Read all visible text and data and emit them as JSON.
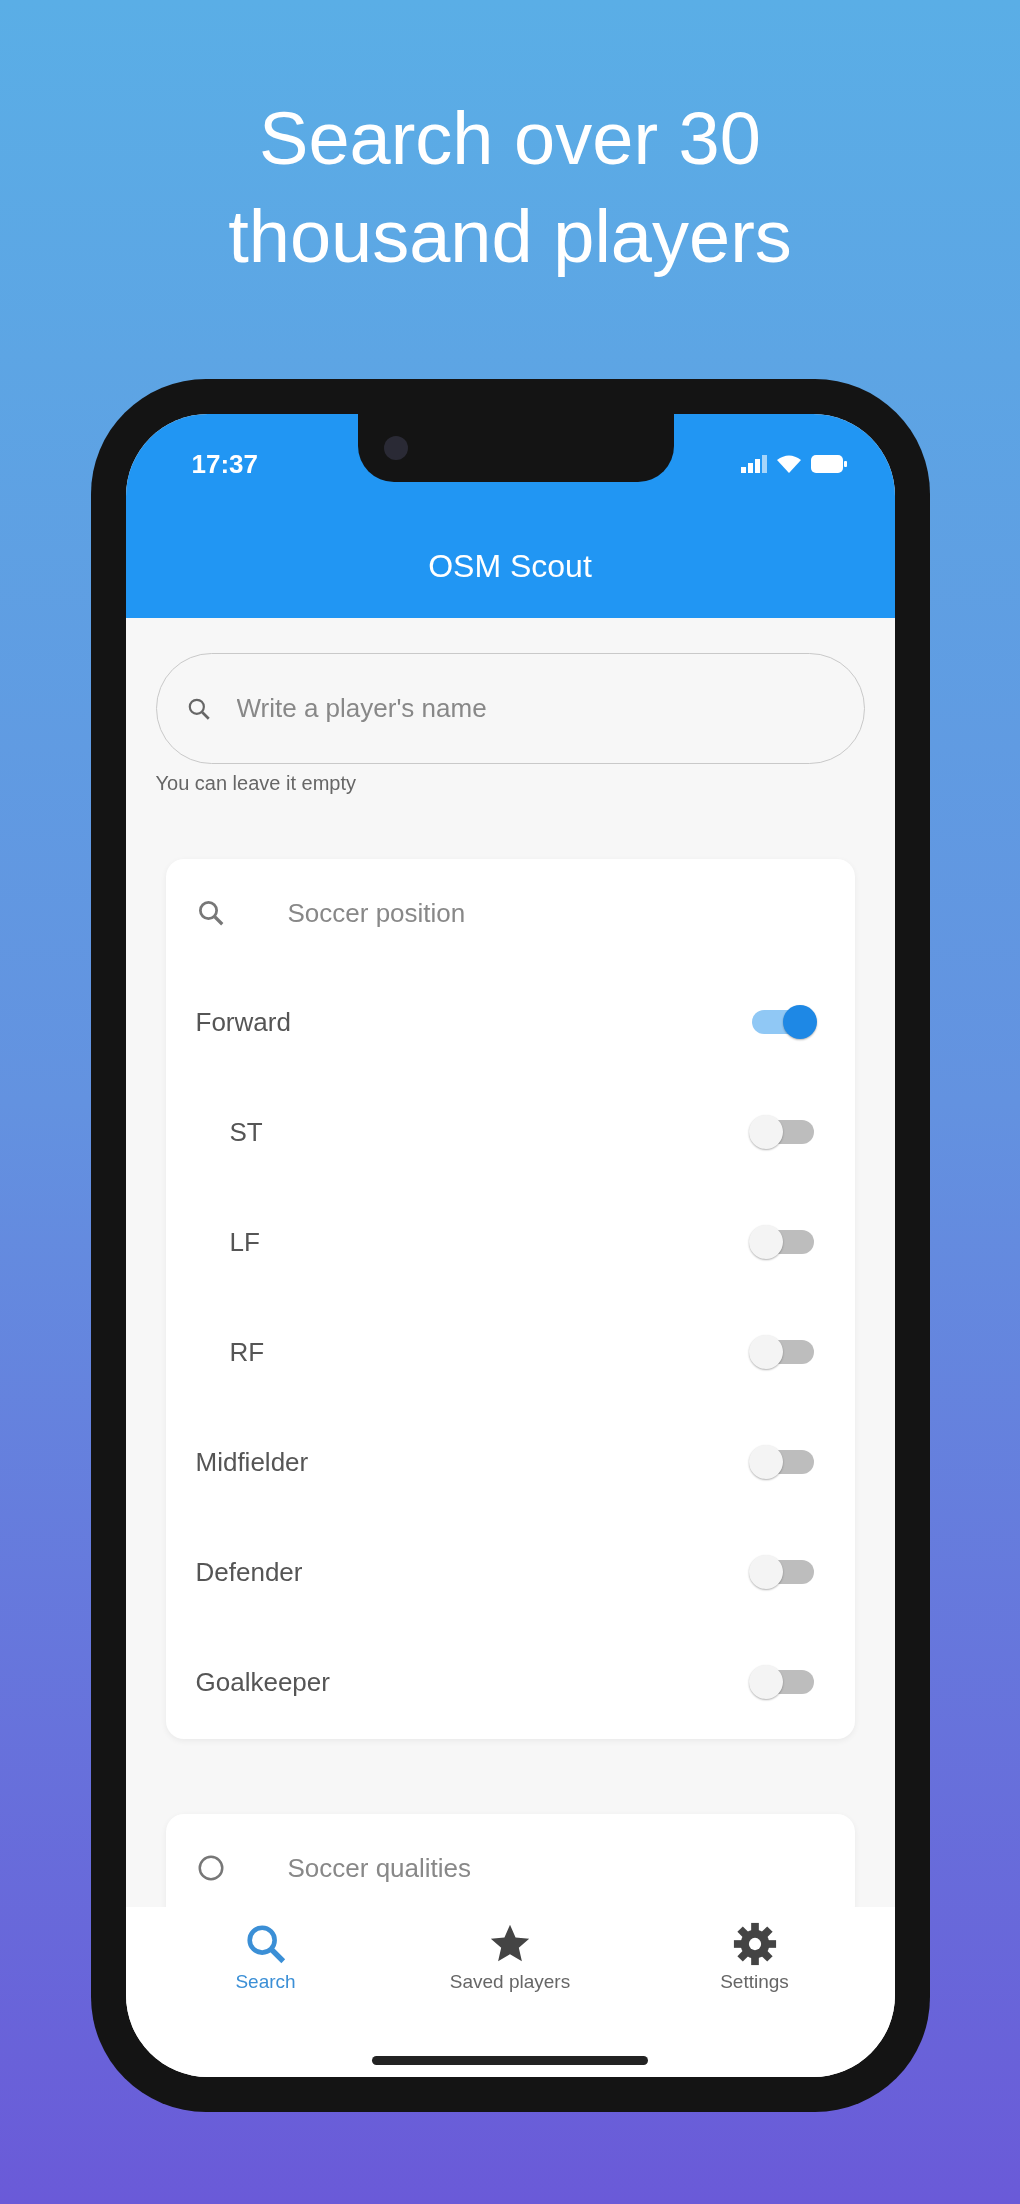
{
  "headline": "Search over 30 thousand players",
  "status_bar": {
    "time": "17:37"
  },
  "app_bar": {
    "title": "OSM Scout"
  },
  "search": {
    "placeholder": "Write a player's name",
    "helper": "You can leave it empty"
  },
  "position_filter": {
    "placeholder": "Soccer position",
    "options": [
      {
        "label": "Forward",
        "on": true,
        "children": [
          {
            "label": "ST",
            "on": false
          },
          {
            "label": "LF",
            "on": false
          },
          {
            "label": "RF",
            "on": false
          }
        ]
      },
      {
        "label": "Midfielder",
        "on": false
      },
      {
        "label": "Defender",
        "on": false
      },
      {
        "label": "Goalkeeper",
        "on": false
      }
    ]
  },
  "qualities_filter": {
    "placeholder": "Soccer qualities"
  },
  "nav": [
    {
      "kind": "search",
      "label": "Search",
      "selected": true
    },
    {
      "kind": "star",
      "label": "Saved players",
      "selected": false
    },
    {
      "kind": "settings",
      "label": "Settings",
      "selected": false
    }
  ]
}
